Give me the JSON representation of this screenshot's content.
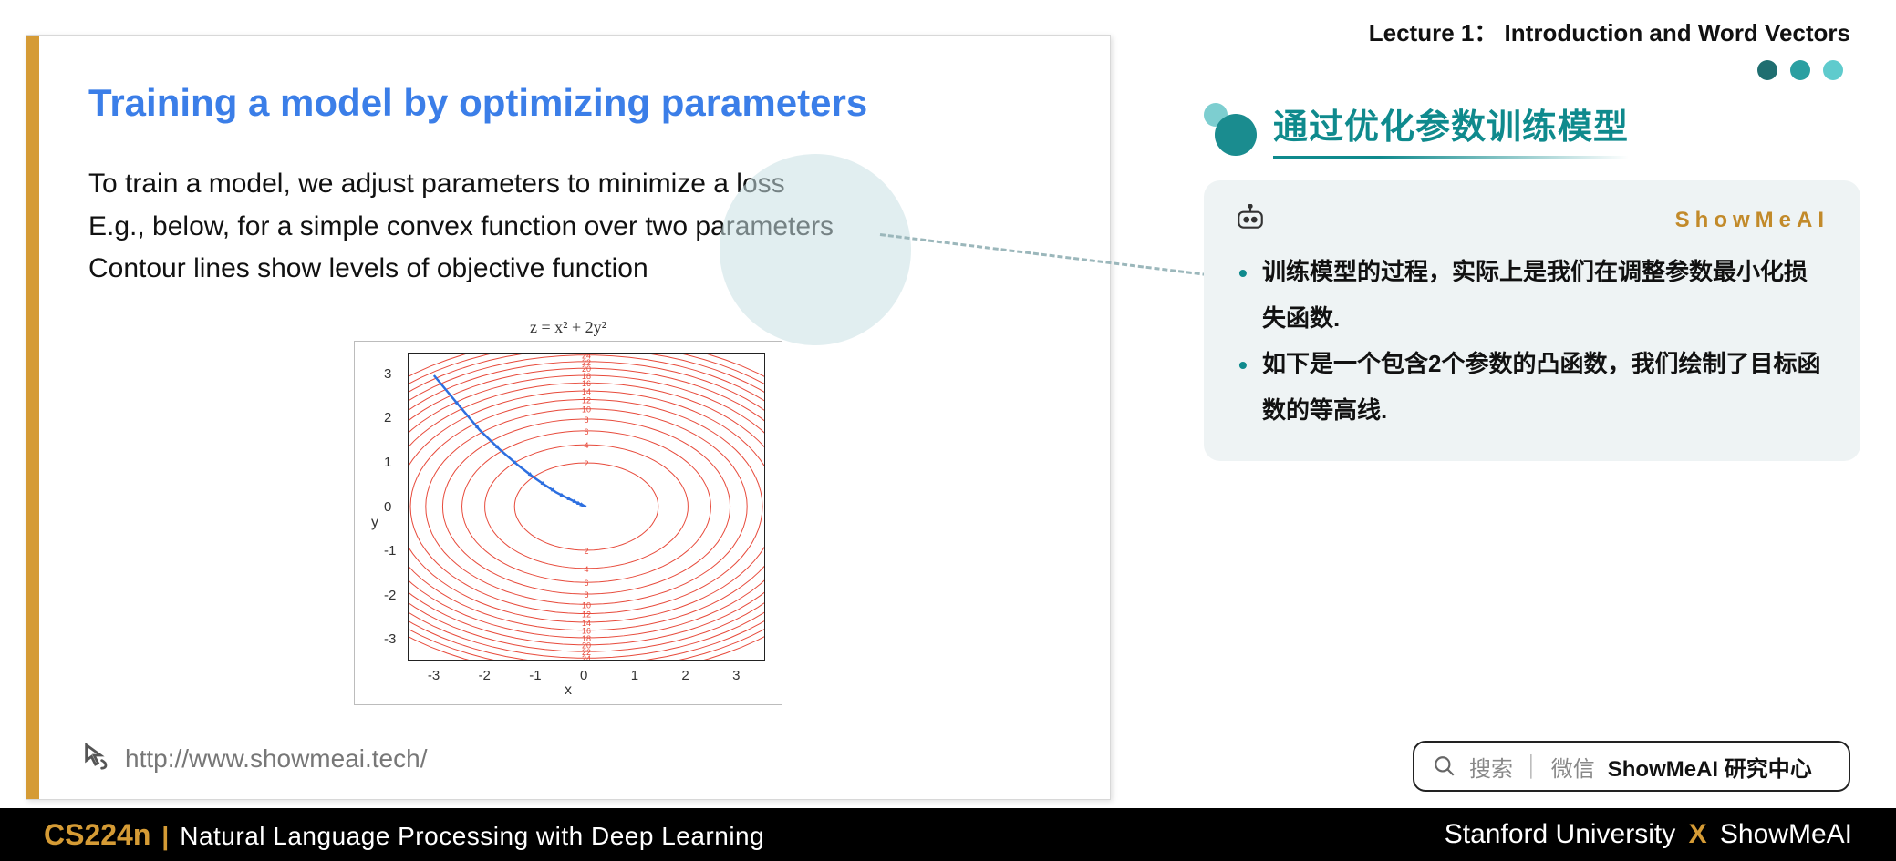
{
  "lecture_label": "Lecture 1： Introduction and Word Vectors",
  "slide": {
    "title": "Training a model by optimizing parameters",
    "line1": "To train a model, we adjust parameters to minimize a loss",
    "line2": "E.g., below, for a simple convex function over two parameters",
    "line3": "Contour lines show levels of objective function",
    "link": "http://www.showmeai.tech/"
  },
  "right": {
    "title": "通过优化参数训练模型",
    "brand": "ShowMeAI",
    "bullets": {
      "0": "训练模型的过程，实际上是我们在调整参数最小化损失函数.",
      "1": "如下是一个包含2个参数的凸函数，我们绘制了目标函数的等高线."
    }
  },
  "search": {
    "hint": "搜索",
    "channel": "微信",
    "strong": "ShowMeAI 研究中心"
  },
  "footer": {
    "code": "CS224n",
    "course": "Natural Language Processing with Deep Learning",
    "uni": "Stanford University",
    "org": "ShowMeAI"
  },
  "chart_data": {
    "type": "contour",
    "title": "z = x² + 2y²",
    "xlabel": "x",
    "ylabel": "y",
    "xlim": [
      -3.5,
      3.5
    ],
    "ylim": [
      -3.5,
      3.5
    ],
    "x_ticks": [
      -3,
      -2,
      -1,
      0,
      1,
      2,
      3
    ],
    "y_ticks": [
      -3,
      -2,
      -1,
      0,
      1,
      2,
      3
    ],
    "contour_levels": [
      2,
      4,
      6,
      8,
      10,
      12,
      14,
      16,
      18,
      20,
      22,
      24,
      26,
      28,
      30
    ],
    "gradient_path": {
      "description": "gradient descent path from start to minimum",
      "start": [
        -3.0,
        3.0
      ],
      "end": [
        0.0,
        0.0
      ],
      "points": [
        [
          -3.0,
          3.0
        ],
        [
          -2.5,
          2.3
        ],
        [
          -2.1,
          1.75
        ],
        [
          -1.7,
          1.3
        ],
        [
          -1.35,
          0.95
        ],
        [
          -1.05,
          0.68
        ],
        [
          -0.8,
          0.48
        ],
        [
          -0.6,
          0.33
        ],
        [
          -0.42,
          0.22
        ],
        [
          -0.28,
          0.14
        ],
        [
          -0.17,
          0.08
        ],
        [
          -0.09,
          0.04
        ],
        [
          -0.03,
          0.01
        ],
        [
          0.0,
          0.0
        ]
      ]
    }
  }
}
